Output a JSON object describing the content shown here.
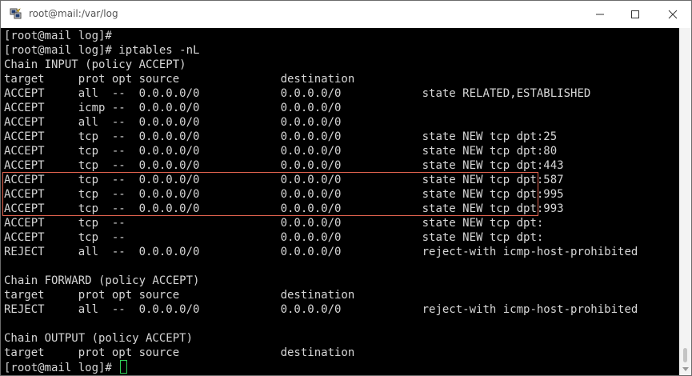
{
  "window": {
    "title": "root@mail:/var/log",
    "icon": "putty-terminal-icon"
  },
  "controls": {
    "minimize_icon": "minimize-icon",
    "maximize_icon": "maximize-icon",
    "close_icon": "close-icon"
  },
  "terminal": {
    "lines": [
      "[root@mail log]#",
      "[root@mail log]# iptables -nL",
      "Chain INPUT (policy ACCEPT)",
      "target     prot opt source               destination",
      "ACCEPT     all  --  0.0.0.0/0            0.0.0.0/0            state RELATED,ESTABLISHED",
      "ACCEPT     icmp --  0.0.0.0/0            0.0.0.0/0",
      "ACCEPT     all  --  0.0.0.0/0            0.0.0.0/0",
      "ACCEPT     tcp  --  0.0.0.0/0            0.0.0.0/0            state NEW tcp dpt:25",
      "ACCEPT     tcp  --  0.0.0.0/0            0.0.0.0/0            state NEW tcp dpt:80",
      "ACCEPT     tcp  --  0.0.0.0/0            0.0.0.0/0            state NEW tcp dpt:443",
      "ACCEPT     tcp  --  0.0.0.0/0            0.0.0.0/0            state NEW tcp dpt:587",
      "ACCEPT     tcp  --  0.0.0.0/0            0.0.0.0/0            state NEW tcp dpt:995",
      "ACCEPT     tcp  --  0.0.0.0/0            0.0.0.0/0            state NEW tcp dpt:993",
      "ACCEPT     tcp  --                       0.0.0.0/0            state NEW tcp dpt:",
      "ACCEPT     tcp  --                       0.0.0.0/0            state NEW tcp dpt:",
      "REJECT     all  --  0.0.0.0/0            0.0.0.0/0            reject-with icmp-host-prohibited",
      "",
      "Chain FORWARD (policy ACCEPT)",
      "target     prot opt source               destination",
      "REJECT     all  --  0.0.0.0/0            0.0.0.0/0            reject-with icmp-host-prohibited",
      "",
      "Chain OUTPUT (policy ACCEPT)",
      "target     prot opt source               destination",
      "[root@mail log]# "
    ],
    "colors": {
      "background": "#000000",
      "text": "#d6d6d6",
      "cursor": "#30d158",
      "highlight_box": "#e0634f"
    }
  }
}
